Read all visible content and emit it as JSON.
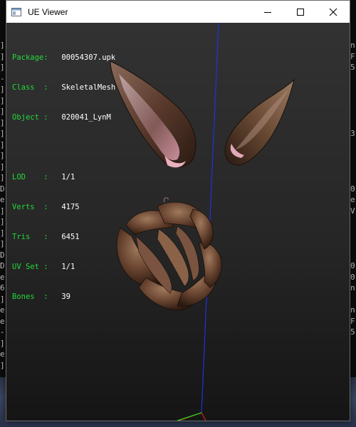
{
  "window": {
    "title": "UE Viewer",
    "icons": [
      "app-window-icon",
      "minimize-icon",
      "maximize-icon",
      "close-icon"
    ]
  },
  "info": {
    "package_label": "Package:",
    "package_value": "00054307.upk",
    "class_label": "Class  :",
    "class_value": "SkeletalMesh",
    "object_label": "Object :",
    "object_value": "020041_LynM",
    "lod_label": "LOD    :",
    "lod_value": "1/1",
    "verts_label": "Verts  :",
    "verts_value": "4175",
    "tris_label": "Tris   :",
    "tris_value": "6451",
    "uvset_label": "UV Set :",
    "uvset_value": "1/1",
    "bones_label": "Bones  :",
    "bones_value": "39"
  },
  "background_console": {
    "left_chars": [
      "]",
      "]",
      "]",
      "-",
      "]",
      "]",
      "]",
      "]",
      "]",
      "]",
      "]",
      "]",
      "]",
      "D",
      "e",
      "]",
      "]",
      "]",
      "]",
      "D",
      "D",
      "e",
      "6",
      "]",
      "e",
      "e",
      "-",
      "]",
      "e",
      "]"
    ],
    "right_chars": [
      "n",
      "F",
      "5",
      "",
      "",
      "",
      "",
      "",
      "3",
      "",
      "",
      "",
      "",
      "0",
      "e",
      "V",
      "",
      "",
      "",
      "",
      "0",
      "0",
      "n",
      "",
      "n",
      "F",
      "5",
      "",
      "",
      ""
    ]
  },
  "colors": {
    "label_green": "#22d83a",
    "axis_blue": "#1f33d8",
    "axis_red": "#d81f1f",
    "axis_green": "#1fd81f",
    "mesh_brown": "#6b4632"
  }
}
